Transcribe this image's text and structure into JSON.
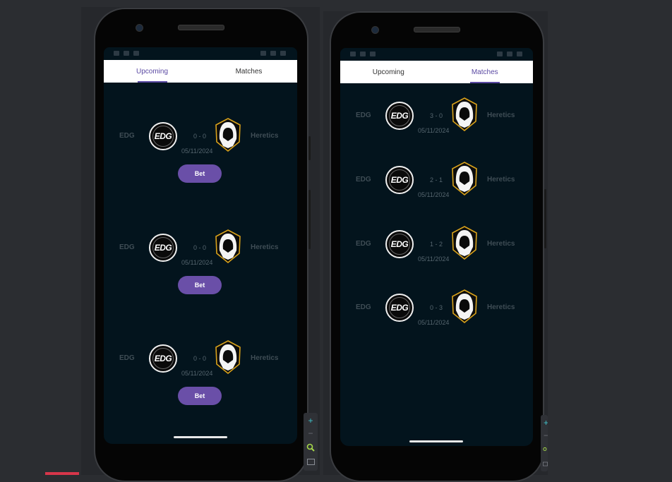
{
  "left_phone": {
    "tabs": [
      {
        "label": "Upcoming",
        "active": true
      },
      {
        "label": "Matches",
        "active": false
      }
    ],
    "matches": [
      {
        "team_a": "EDG",
        "team_b": "Heretics",
        "score": "0 - 0",
        "date": "05/11/2024",
        "bet_label": "Bet"
      },
      {
        "team_a": "EDG",
        "team_b": "Heretics",
        "score": "0 - 0",
        "date": "05/11/2024",
        "bet_label": "Bet"
      },
      {
        "team_a": "EDG",
        "team_b": "Heretics",
        "score": "0 - 0",
        "date": "05/11/2024",
        "bet_label": "Bet"
      }
    ]
  },
  "right_phone": {
    "tabs": [
      {
        "label": "Upcoming",
        "active": false
      },
      {
        "label": "Matches",
        "active": true
      }
    ],
    "matches": [
      {
        "team_a": "EDG",
        "team_b": "Heretics",
        "score": "3 - 0",
        "date": "05/11/2024"
      },
      {
        "team_a": "EDG",
        "team_b": "Heretics",
        "score": "2 - 1",
        "date": "05/11/2024"
      },
      {
        "team_a": "EDG",
        "team_b": "Heretics",
        "score": "1 - 2",
        "date": "05/11/2024"
      },
      {
        "team_a": "EDG",
        "team_b": "Heretics",
        "score": "0 - 3",
        "date": "05/11/2024"
      }
    ]
  },
  "logos": {
    "edg_text": "EDG"
  },
  "zoom_panel": {
    "plus": "+",
    "minus": "−"
  },
  "colors": {
    "screen_bg": "#03141d",
    "accent": "#5b4aa3",
    "bet_button": "#6a4fa8",
    "heretics_gold": "#d9a21b"
  }
}
